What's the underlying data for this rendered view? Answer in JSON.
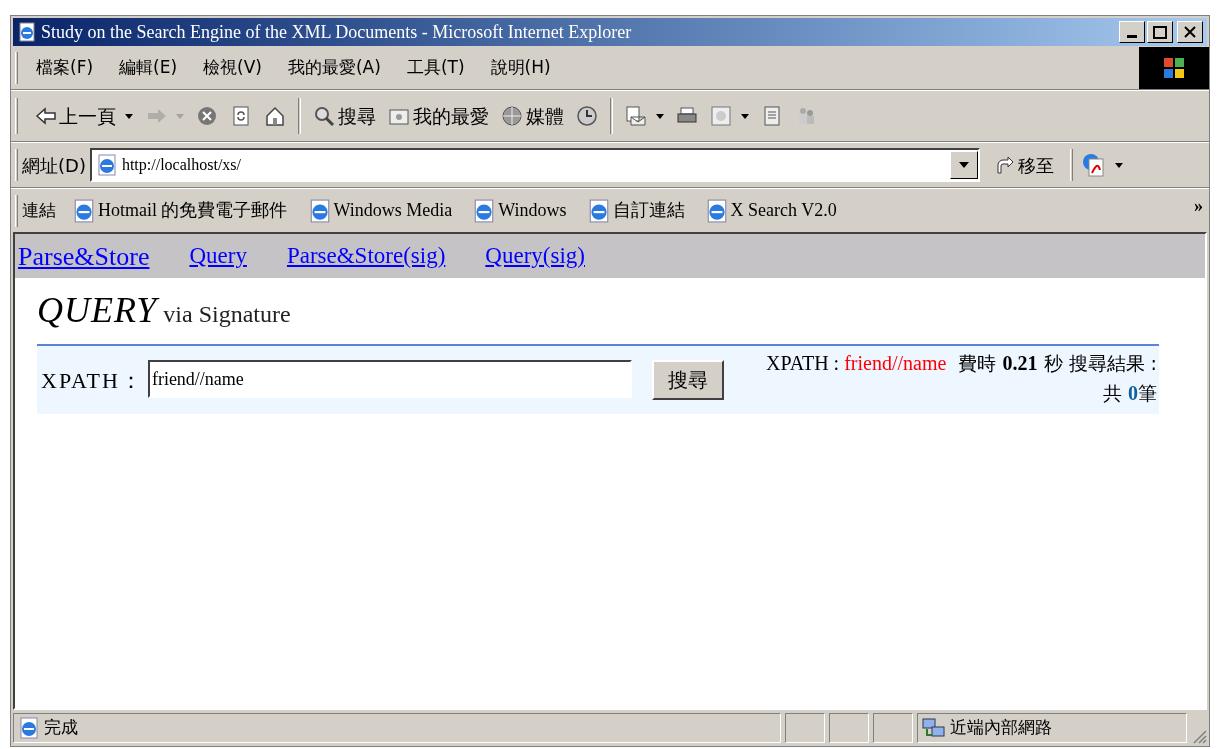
{
  "window": {
    "title": "Study on the Search Engine of the XML Documents - Microsoft Internet Explorer"
  },
  "menu": [
    "檔案(F)",
    "編輯(E)",
    "檢視(V)",
    "我的最愛(A)",
    "工具(T)",
    "說明(H)"
  ],
  "toolbar": [
    {
      "kind": "back",
      "label": "上一頁",
      "disabled": false
    },
    {
      "kind": "forward",
      "disabled": true
    },
    {
      "kind": "stop"
    },
    {
      "kind": "refresh"
    },
    {
      "kind": "home"
    },
    {
      "kind": "sep"
    },
    {
      "kind": "search",
      "label": "搜尋"
    },
    {
      "kind": "favorites",
      "label": "我的最愛"
    },
    {
      "kind": "media",
      "label": "媒體"
    },
    {
      "kind": "history"
    },
    {
      "kind": "sep"
    },
    {
      "kind": "mail"
    },
    {
      "kind": "print"
    },
    {
      "kind": "edit"
    },
    {
      "kind": "discuss"
    },
    {
      "kind": "messenger"
    }
  ],
  "address": {
    "label": "網址(D)",
    "value": "http://localhost/xs/",
    "go": "移至"
  },
  "links": {
    "label": "連結",
    "items": [
      "Hotmail 的免費電子郵件",
      "Windows Media",
      "Windows",
      "自訂連結",
      "X Search V2.0"
    ],
    "more": "»"
  },
  "nav": [
    {
      "label": "Parse&Store",
      "selected": true
    },
    {
      "label": "Query",
      "selected": false
    },
    {
      "label": "Parse&Store(sig)",
      "selected": false
    },
    {
      "label": "Query(sig)",
      "selected": false
    }
  ],
  "heading": {
    "title": "QUERY",
    "subtitle": "via Signature"
  },
  "search": {
    "label": "XPATH：",
    "value": "friend//name",
    "button": "搜尋"
  },
  "result": {
    "xpath_label": "XPATH :",
    "xpath": "friend//name",
    "time_label": "費時",
    "time": "0.21",
    "time_unit": "秒 搜尋結果 : 共",
    "count": "0",
    "count_unit": "筆"
  },
  "status_bar": {
    "text": "完成",
    "zone": "近端內部網路"
  }
}
